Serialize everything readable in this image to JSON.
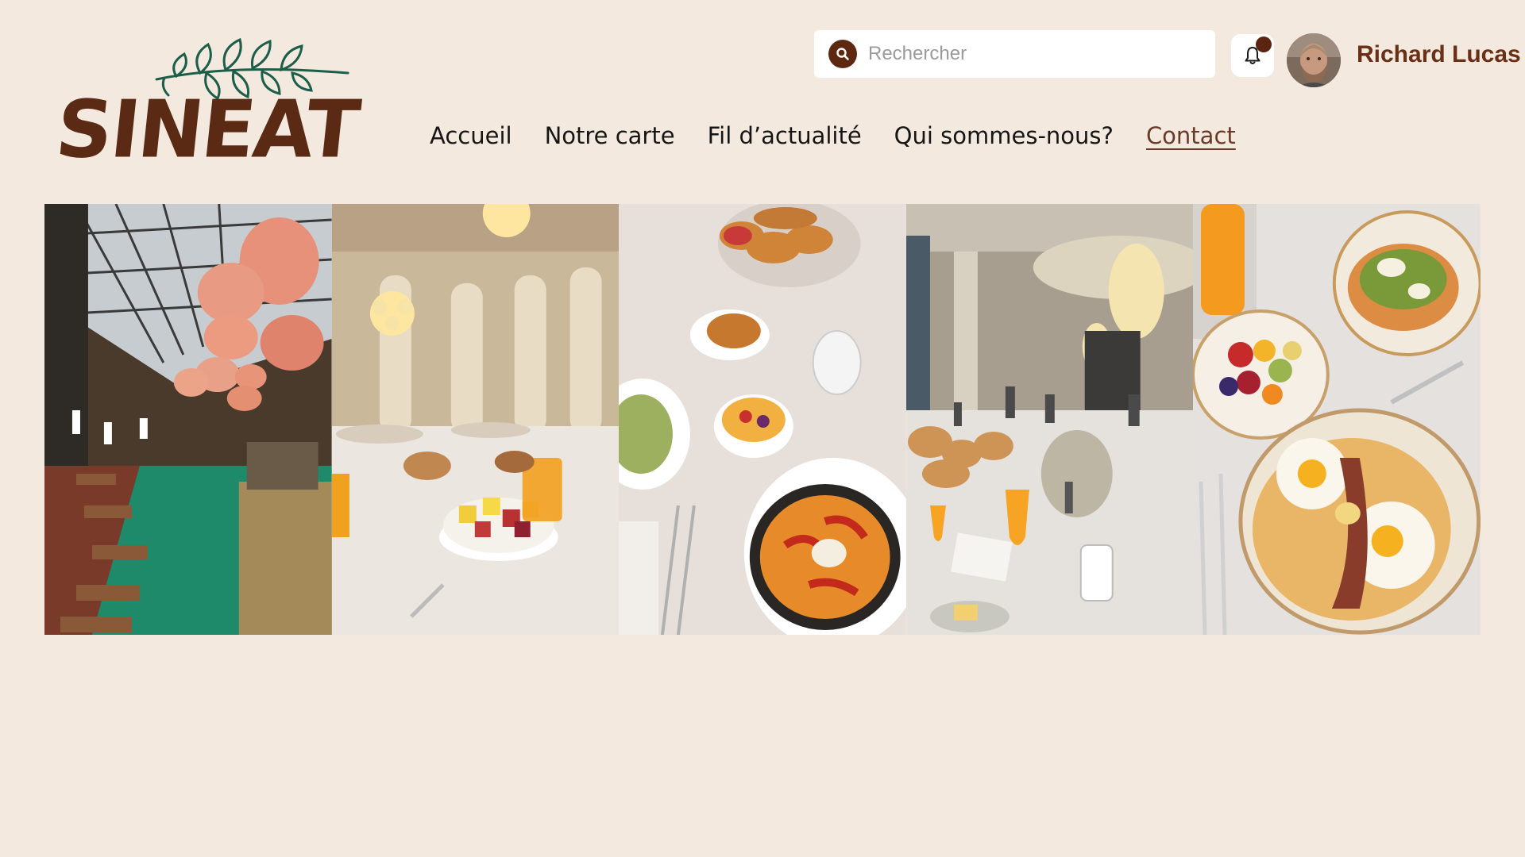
{
  "brand": {
    "logo_text": "SINEAT",
    "color": "#5a2a14",
    "leaf_color": "#1d5e4a"
  },
  "search": {
    "placeholder": "Rechercher",
    "value": "",
    "icon": "search-icon"
  },
  "notifications": {
    "icon": "bell-icon",
    "has_unread": true
  },
  "user": {
    "name": "Richard Lucas"
  },
  "nav": {
    "items": [
      {
        "label": "Accueil",
        "active": false
      },
      {
        "label": "Notre carte",
        "active": false
      },
      {
        "label": "Fil d’actualité",
        "active": false
      },
      {
        "label": "Qui sommes-nous?",
        "active": false
      },
      {
        "label": "Contact",
        "active": true
      }
    ]
  },
  "gallery": {
    "photos": [
      "restaurant-interior-lanterns",
      "chandelier-dining-room-breakfast",
      "breakfast-table-croissants-shakshuka",
      "grand-dining-hall-orange-juice",
      "eggs-avocado-toast-fruit-bowl"
    ]
  },
  "colors": {
    "background": "#f3e9df",
    "accent": "#5e2810",
    "link_active": "#6a3a28"
  }
}
